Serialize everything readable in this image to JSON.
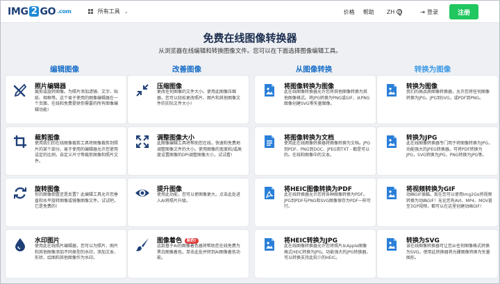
{
  "header": {
    "logo": {
      "part1": "IMG",
      "part2": "2",
      "part3": "GO",
      "dot": ".com"
    },
    "all_tools": "所有工具",
    "links": [
      "价格",
      "帮助"
    ],
    "language": "ZH",
    "login": "登录",
    "signup": "注册"
  },
  "title": "免费在线图像转换器",
  "subtitle": "从浏览器在线编辑和转换图像文件。您可以在下面选择图像编辑工具。",
  "columns": [
    "编辑图像",
    "改善图像",
    "从图像转换",
    "转换为图像"
  ],
  "cards": [
    {
      "title": "照片编辑器",
      "badge": "",
      "icon": "tools-icon",
      "desc": "裁剪或旋转图像。为照片添加滤镜、文字、贴纸、相框等。这个易于使用的图像编辑器在一个页面、在线和免费提供你需要的所有图像编辑功能!"
    },
    {
      "title": "压缩图像",
      "badge": "",
      "icon": "compress-icon",
      "desc": "更改任何图像的文件大小。使用此图像压缩器，您可以轻松更改照片、图片和其他图像文件的实际文件大小!"
    },
    {
      "title": "将图像转换为图像",
      "badge": "",
      "icon": "image-file-icon",
      "desc": "此在线图像转换器允许您将其他图像转换为其他图像格式。将JPG转换为PNG或GIF，从PNG图像创建SVG等矢量图像。"
    },
    {
      "title": "转换为图像",
      "badge": "",
      "icon": "image-file-icon",
      "desc": "我们的高品质图像转换器，允许您将任何图像转换为JPG、JPG到SVG，或PDF到PNG。"
    },
    {
      "title": "裁剪图像",
      "badge": "",
      "icon": "crop-icon",
      "desc": "使用我们的在线图像裁剪工具将图像裁剪到照片的某个部分。易于使用的编辑器允许您使用设定的比例，自定义尺寸等裁剪图像和照片文件。"
    },
    {
      "title": "调整图像大小",
      "badge": "",
      "icon": "resize-icon",
      "desc": "此图像编辑工具将帮助您在线，快速和免费地调整图像文件的大小。使用图像的宽度和/或高度设置图像的DPI调整图像大小，试试看!"
    },
    {
      "title": "将图像转换为文档",
      "badge": "",
      "icon": "document-icon",
      "desc": "使用此在线图像转换器将图像转换为文档。JPG到PDF、PNG到DOC、JPEG到TXT - 都是可以的。在线和图像中的文本。"
    },
    {
      "title": "转换为JPG",
      "badge": "",
      "icon": "image-file-icon",
      "desc": "此在线图像转换器专门用于将图像转换为JPG，功能强大的JPEG转换器。可将PDF转换为JPG，SVG转换为JPG，PNG转换为JPG等。"
    },
    {
      "title": "旋转图像",
      "badge": "",
      "icon": "rotate-icon",
      "desc": "你的图像倒置还是反置？此编辑工具允许您垂直和水平旋转图像或镜像图像文件。试试吧，它是免费的!"
    },
    {
      "title": "提升图像",
      "badge": "",
      "icon": "eye-icon",
      "desc": "使用此功能，您可以使图像更大。点击此处进入AI将照片升级。"
    },
    {
      "title": "将HEIC图像转换为PDF",
      "badge": "",
      "icon": "pdf-icon",
      "desc": "此在线转换器允许您将各种图像转换为PDF。JPG到PDF与PNG和SVG图像保存为PDF一样可行。"
    },
    {
      "title": "将视频转换为GIF",
      "badge": "",
      "icon": "image-file-icon",
      "desc": "动画GIF很酷。现在您可以使用Img2Go将视频转换为动画GIF！无论您有AVI、MP4、MOV甚至3GP视频，都可以在这里创建动画GIF!"
    },
    {
      "title": "水印图片",
      "badge": "",
      "icon": "drop-icon",
      "desc": "使用此在线照片编辑器，您可以为照片、图片和其他图像添加不同类型的水印，添加文本、形状、绘图和其他图像作为水印。"
    },
    {
      "title": "图像着色",
      "badge": "新的!",
      "icon": "brush-icon",
      "desc": "这款基于AI的图像着色器将帮助您在线免费为黑白图像着色。单击此处并转到AI图像着色功能。"
    },
    {
      "title": "将HEIC转换为JPG",
      "badge": "",
      "icon": "image-file-icon",
      "desc": "此在线图像转换器允许您将照片从Apple图像格式HEIC转换为JPG。功能强大的JPG转换器，可以转换支持此较少的HEIC。"
    },
    {
      "title": "转换为SVG",
      "badge": "",
      "icon": "image-file-icon",
      "desc": "该在线图像转换器可让您从任何图像格式转换为SVG。使用此转换器将光栅图像转换为矢量图形。"
    }
  ],
  "colors": {
    "accent": "#1a6fc8",
    "accent_light": "#3f9be8",
    "signup": "#20c65e",
    "title": "#1b2d4f",
    "badge": "#e23a3a"
  }
}
